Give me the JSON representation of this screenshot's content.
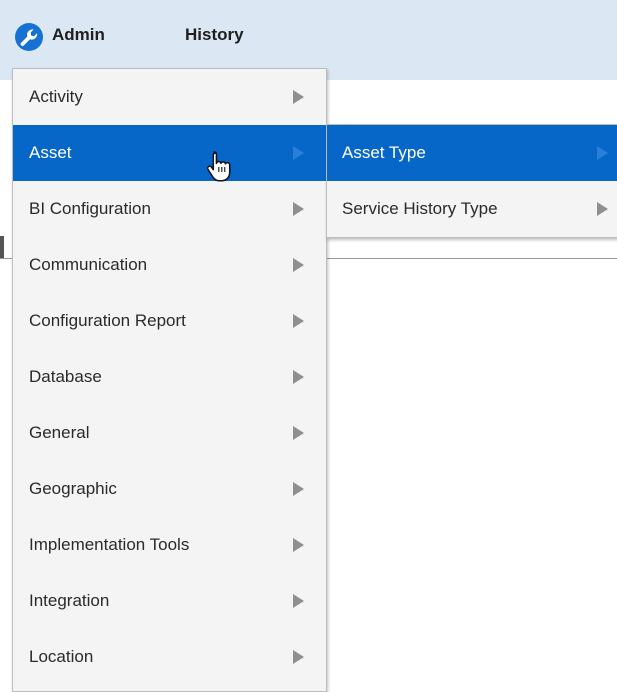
{
  "header": {
    "nav": [
      {
        "label": "Admin"
      },
      {
        "label": "History"
      }
    ]
  },
  "admin_menu": {
    "items": [
      {
        "label": "Activity",
        "selected": false
      },
      {
        "label": "Asset",
        "selected": true
      },
      {
        "label": "BI Configuration",
        "selected": false
      },
      {
        "label": "Communication",
        "selected": false
      },
      {
        "label": "Configuration Report",
        "selected": false
      },
      {
        "label": "Database",
        "selected": false
      },
      {
        "label": "General",
        "selected": false
      },
      {
        "label": "Geographic",
        "selected": false
      },
      {
        "label": "Implementation Tools",
        "selected": false
      },
      {
        "label": "Integration",
        "selected": false
      },
      {
        "label": "Location",
        "selected": false
      }
    ]
  },
  "asset_submenu": {
    "items": [
      {
        "label": "Asset Type",
        "selected": true
      },
      {
        "label": "Service History Type",
        "selected": false
      }
    ]
  },
  "colors": {
    "header_bg": "#dbe7f2",
    "selected_bg": "#0667c8",
    "menu_bg": "#f4f4f4",
    "logo_blue": "#1572d3"
  },
  "icons": {
    "logo": "wrench-logo-icon",
    "submenu_arrow": "triangle-right-icon",
    "cursor": "hand-pointer-icon"
  }
}
